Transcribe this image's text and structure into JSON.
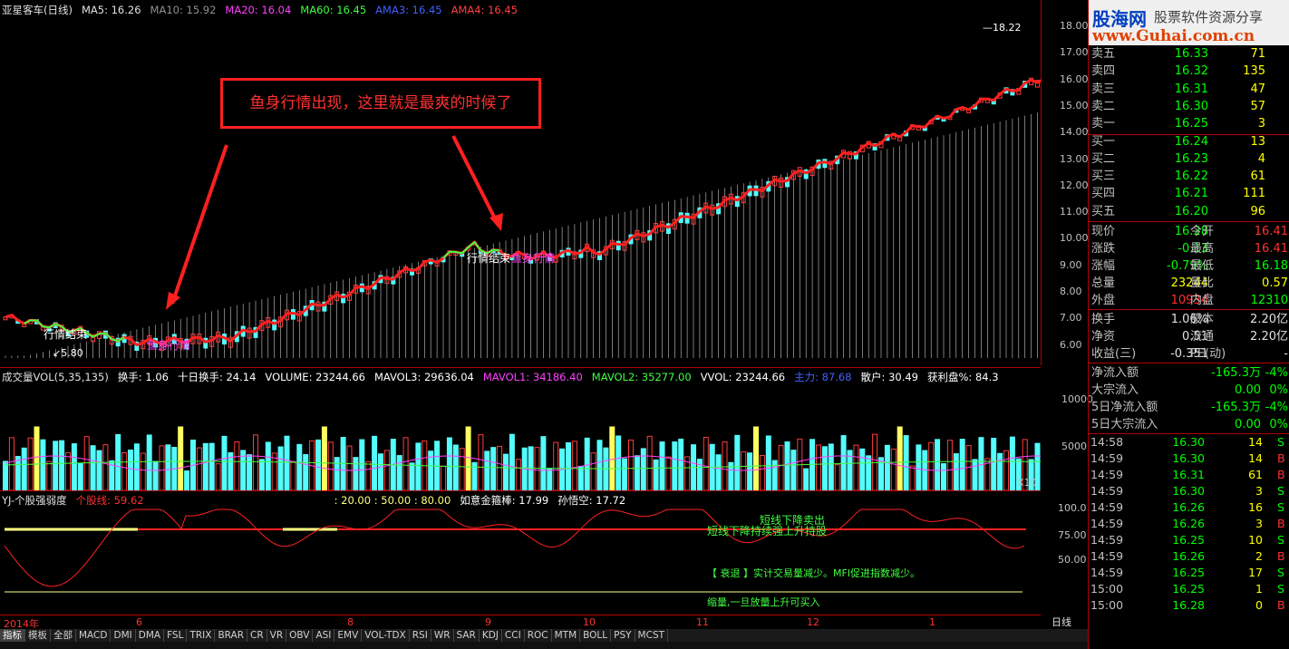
{
  "main_header": {
    "name": "亚星客车(日线)",
    "ma5": "MA5: 16.26",
    "ma10": "MA10: 15.92",
    "ma20": "MA20: 16.04",
    "ma60": "MA60: 16.45",
    "ama3": "AMA3: 16.45",
    "ama4": "AMA4: 16.45"
  },
  "annotations": {
    "callout": "鱼身行情出现，这里就是最爽的时候了",
    "end1": "行情结束",
    "fish1": "鱼身行情",
    "end2": "行情结束",
    "fish2": "鱼身行情",
    "high_label": "18.22",
    "low_label": "5.80"
  },
  "price_axis": [
    "18.00",
    "17.00",
    "16.00",
    "15.00",
    "14.00",
    "13.00",
    "12.00",
    "11.00",
    "10.00",
    "9.00",
    "8.00",
    "7.00",
    "6.00"
  ],
  "vol_header": {
    "name": "成交量VOL(5,35,135)",
    "turnover": "换手: 1.06",
    "ten_day": "十日换手: 24.14",
    "volume": "VOLUME: 23244.66",
    "mavol3": "MAVOL3: 29636.04",
    "mavol1": "MAVOL1: 34186.40",
    "mavol2": "MAVOL2: 35277.00",
    "vvol": "VVOL: 23244.66",
    "main_force": "主力: 87.68",
    "retail": "散户: 30.49",
    "profit": "获利盘%: 84.3"
  },
  "vol_axis": [
    "10000",
    "5000"
  ],
  "vol_unit": "X10",
  "osc_header": {
    "name": "YJ-个股强弱度",
    "stock_line": "个股线: 59.62",
    "levels": ": 20.00 : 50.00 : 80.00",
    "ruyi": "如意金箍棒: 17.99",
    "wukong": "孙悟空: 17.72"
  },
  "osc_axis": [
    "100.0",
    "75.00",
    "50.00"
  ],
  "osc_notes": {
    "short_sell": "短线下降卖出",
    "short_hold": "短线下降持续强上升持股",
    "decline": "【 衰退 】实计交易量减少。MFI促进指数减少。",
    "shrink": "缩量,一旦放量上升可买入"
  },
  "time_axis": [
    "2014年",
    "6",
    "8",
    "9",
    "10",
    "11",
    "12",
    "1"
  ],
  "period": "日线",
  "tabs": [
    "指标",
    "模板",
    "全部",
    "MACD",
    "DMI",
    "DMA",
    "FSL",
    "TRIX",
    "BRAR",
    "CR",
    "VR",
    "OBV",
    "ASI",
    "EMV",
    "VOL-TDX",
    "RSI",
    "WR",
    "SAR",
    "KDJ",
    "CCI",
    "ROC",
    "MTM",
    "BOLL",
    "PSY",
    "MCST"
  ],
  "logo": {
    "title": "股海网",
    "slogan": "股票软件资源分享",
    "url": "www.Guhai.com.cn"
  },
  "order_book": {
    "sell": [
      {
        "label": "卖五",
        "price": "16.33",
        "vol": "71"
      },
      {
        "label": "卖四",
        "price": "16.32",
        "vol": "135"
      },
      {
        "label": "卖三",
        "price": "16.31",
        "vol": "47"
      },
      {
        "label": "卖二",
        "price": "16.30",
        "vol": "57"
      },
      {
        "label": "卖一",
        "price": "16.25",
        "vol": "3"
      }
    ],
    "buy": [
      {
        "label": "买一",
        "price": "16.24",
        "vol": "13"
      },
      {
        "label": "买二",
        "price": "16.23",
        "vol": "4"
      },
      {
        "label": "买三",
        "price": "16.22",
        "vol": "61"
      },
      {
        "label": "买四",
        "price": "16.21",
        "vol": "111"
      },
      {
        "label": "买五",
        "price": "16.20",
        "vol": "96"
      }
    ]
  },
  "stats": [
    {
      "k1": "现价",
      "v1": "16.28",
      "k2": "今开",
      "v2": "16.41",
      "c1": "#00ff00",
      "c2": "#ff3030"
    },
    {
      "k1": "涨跌",
      "v1": "-0.13",
      "k2": "最高",
      "v2": "16.41",
      "c1": "#00ff00",
      "c2": "#ff3030"
    },
    {
      "k1": "涨幅",
      "v1": "-0.79%",
      "k2": "最低",
      "v2": "16.18",
      "c1": "#00ff00",
      "c2": "#00ff00"
    },
    {
      "k1": "总量",
      "v1": "23244",
      "k2": "量比",
      "v2": "0.57",
      "c1": "#ffff00",
      "c2": "#ffff00"
    },
    {
      "k1": "外盘",
      "v1": "10934",
      "k2": "内盘",
      "v2": "12310",
      "c1": "#ff3030",
      "c2": "#00ff00"
    }
  ],
  "fundamentals": [
    {
      "k1": "换手",
      "v1": "1.06%",
      "k2": "股本",
      "v2": "2.20亿"
    },
    {
      "k1": "净资",
      "v1": "0.51",
      "k2": "流通",
      "v2": "2.20亿"
    },
    {
      "k1": "收益(三)",
      "v1": "-0.351",
      "k2": "PE(动)",
      "v2": "-"
    }
  ],
  "flows": [
    {
      "k": "净流入额",
      "v": "-165.3万",
      "p": "-4%"
    },
    {
      "k": "大宗流入",
      "v": "0.00",
      "p": "0%"
    },
    {
      "k": "5日净流入额",
      "v": "-165.3万",
      "p": "-4%"
    },
    {
      "k": "5日大宗流入",
      "v": "0.00",
      "p": "0%"
    }
  ],
  "ticks": [
    {
      "t": "14:58",
      "p": "16.30",
      "v": "14",
      "f": "S"
    },
    {
      "t": "14:59",
      "p": "16.30",
      "v": "14",
      "f": "B"
    },
    {
      "t": "14:59",
      "p": "16.31",
      "v": "61",
      "f": "B"
    },
    {
      "t": "14:59",
      "p": "16.30",
      "v": "3",
      "f": "S"
    },
    {
      "t": "14:59",
      "p": "16.26",
      "v": "16",
      "f": "S"
    },
    {
      "t": "14:59",
      "p": "16.26",
      "v": "3",
      "f": "B"
    },
    {
      "t": "14:59",
      "p": "16.25",
      "v": "10",
      "f": "S"
    },
    {
      "t": "14:59",
      "p": "16.26",
      "v": "2",
      "f": "B"
    },
    {
      "t": "14:59",
      "p": "16.25",
      "v": "17",
      "f": "S"
    },
    {
      "t": "15:00",
      "p": "16.25",
      "v": "1",
      "f": "S"
    },
    {
      "t": "15:00",
      "p": "16.28",
      "v": "0",
      "f": "B"
    }
  ]
}
